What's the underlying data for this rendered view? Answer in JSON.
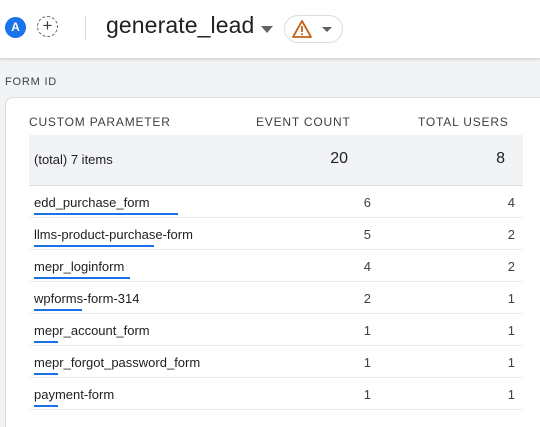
{
  "header": {
    "avatar_letter": "A",
    "add_label": "+",
    "event_name": "generate_lead",
    "warning_icon": "warning-triangle-icon",
    "warning_color": "#c5621c",
    "accent": "#1a73e8"
  },
  "section": {
    "label": "FORM ID"
  },
  "table": {
    "columns": [
      "CUSTOM PARAMETER",
      "EVENT COUNT",
      "TOTAL USERS"
    ],
    "total": {
      "label": "(total) 7 items",
      "event_count": "20",
      "total_users": "8"
    },
    "max_event_count": 6,
    "rows": [
      {
        "name": "edd_purchase_form",
        "event_count": "6",
        "total_users": "4"
      },
      {
        "name": "llms-product-purchase-form",
        "event_count": "5",
        "total_users": "2"
      },
      {
        "name": "mepr_loginform",
        "event_count": "4",
        "total_users": "2"
      },
      {
        "name": "wpforms-form-314",
        "event_count": "2",
        "total_users": "1"
      },
      {
        "name": "mepr_account_form",
        "event_count": "1",
        "total_users": "1"
      },
      {
        "name": "mepr_forgot_password_form",
        "event_count": "1",
        "total_users": "1"
      },
      {
        "name": "payment-form",
        "event_count": "1",
        "total_users": "1"
      }
    ]
  }
}
